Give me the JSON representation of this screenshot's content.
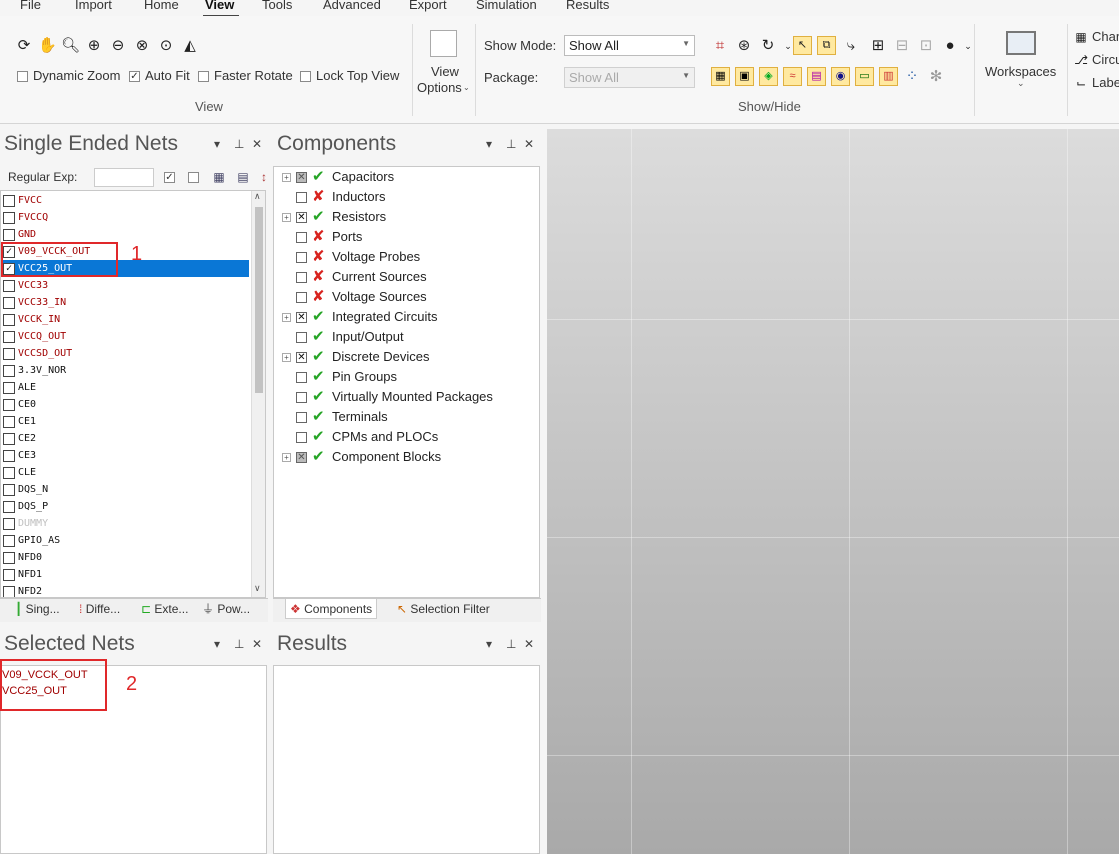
{
  "menu": {
    "items": [
      "File",
      "Import",
      "Home",
      "View",
      "Tools",
      "Advanced",
      "Export",
      "Simulation",
      "Results"
    ],
    "active": "View"
  },
  "ribbon": {
    "view_group": {
      "label": "View",
      "dynamic_zoom": "Dynamic Zoom",
      "auto_fit": "Auto Fit",
      "faster_rotate": "Faster Rotate",
      "lock_top_view": "Lock Top View"
    },
    "view_options": {
      "line1": "View",
      "line2": "Options"
    },
    "show_hide": {
      "label": "Show/Hide",
      "show_mode_label": "Show Mode:",
      "show_mode_value": "Show All",
      "package_label": "Package:",
      "package_value": "Show All"
    },
    "workspaces": "Workspaces",
    "right_items": [
      "Char",
      "Circu",
      "Labe"
    ]
  },
  "nets_panel": {
    "title": "Single Ended Nets",
    "regular_exp_label": "Regular Exp:",
    "nets": [
      {
        "name": "FVCC",
        "checked": false,
        "color": "red"
      },
      {
        "name": "FVCCQ",
        "checked": false,
        "color": "red"
      },
      {
        "name": "GND",
        "checked": false,
        "color": "red"
      },
      {
        "name": "V09_VCCK_OUT",
        "checked": true,
        "color": "red"
      },
      {
        "name": "VCC25_OUT",
        "checked": true,
        "color": "red",
        "selected": true
      },
      {
        "name": "VCC33",
        "checked": false,
        "color": "red"
      },
      {
        "name": "VCC33_IN",
        "checked": false,
        "color": "red"
      },
      {
        "name": "VCCK_IN",
        "checked": false,
        "color": "red"
      },
      {
        "name": "VCCQ_OUT",
        "checked": false,
        "color": "red"
      },
      {
        "name": "VCCSD_OUT",
        "checked": false,
        "color": "red"
      },
      {
        "name": "3.3V_NOR",
        "checked": false,
        "color": "black"
      },
      {
        "name": "ALE",
        "checked": false,
        "color": "black"
      },
      {
        "name": "CE0",
        "checked": false,
        "color": "black"
      },
      {
        "name": "CE1",
        "checked": false,
        "color": "black"
      },
      {
        "name": "CE2",
        "checked": false,
        "color": "black"
      },
      {
        "name": "CE3",
        "checked": false,
        "color": "black"
      },
      {
        "name": "CLE",
        "checked": false,
        "color": "black"
      },
      {
        "name": "DQS_N",
        "checked": false,
        "color": "black"
      },
      {
        "name": "DQS_P",
        "checked": false,
        "color": "black"
      },
      {
        "name": "DUMMY",
        "checked": false,
        "color": "gray"
      },
      {
        "name": "GPIO_AS",
        "checked": false,
        "color": "black"
      },
      {
        "name": "NFD0",
        "checked": false,
        "color": "black"
      },
      {
        "name": "NFD1",
        "checked": false,
        "color": "black"
      },
      {
        "name": "NFD2",
        "checked": false,
        "color": "black"
      }
    ],
    "tabs": [
      "Sing...",
      "Diffe...",
      "Exte...",
      "Pow..."
    ],
    "annotation": "1"
  },
  "components_panel": {
    "title": "Components",
    "items": [
      {
        "name": "Capacitors",
        "expand": true,
        "check": "tri",
        "status": "ok"
      },
      {
        "name": "Inductors",
        "expand": false,
        "check": "none",
        "status": "no"
      },
      {
        "name": "Resistors",
        "expand": true,
        "check": "x",
        "status": "ok"
      },
      {
        "name": "Ports",
        "expand": false,
        "check": "none",
        "status": "no"
      },
      {
        "name": "Voltage Probes",
        "expand": false,
        "check": "none",
        "status": "no"
      },
      {
        "name": "Current Sources",
        "expand": false,
        "check": "none",
        "status": "no"
      },
      {
        "name": "Voltage Sources",
        "expand": false,
        "check": "none",
        "status": "no"
      },
      {
        "name": "Integrated Circuits",
        "expand": true,
        "check": "x",
        "status": "ok"
      },
      {
        "name": "Input/Output",
        "expand": false,
        "check": "none",
        "status": "ok"
      },
      {
        "name": "Discrete Devices",
        "expand": true,
        "check": "x",
        "status": "ok"
      },
      {
        "name": "Pin Groups",
        "expand": false,
        "check": "none",
        "status": "ok"
      },
      {
        "name": "Virtually Mounted Packages",
        "expand": false,
        "check": "none",
        "status": "ok"
      },
      {
        "name": "Terminals",
        "expand": false,
        "check": "none",
        "status": "ok"
      },
      {
        "name": "CPMs and PLOCs",
        "expand": false,
        "check": "none",
        "status": "ok"
      },
      {
        "name": "Component Blocks",
        "expand": true,
        "check": "tri",
        "status": "ok"
      }
    ],
    "tabs": [
      "Components",
      "Selection Filter"
    ]
  },
  "selected_nets_panel": {
    "title": "Selected Nets",
    "nets": [
      "V09_VCCK_OUT",
      "VCC25_OUT"
    ],
    "annotation": "2"
  },
  "results_panel": {
    "title": "Results"
  },
  "colors": {
    "selection": "#0a77d6",
    "net_red": "#a00000",
    "annotation": "#e0282a",
    "ok": "#25a425",
    "no": "#d8231f"
  }
}
